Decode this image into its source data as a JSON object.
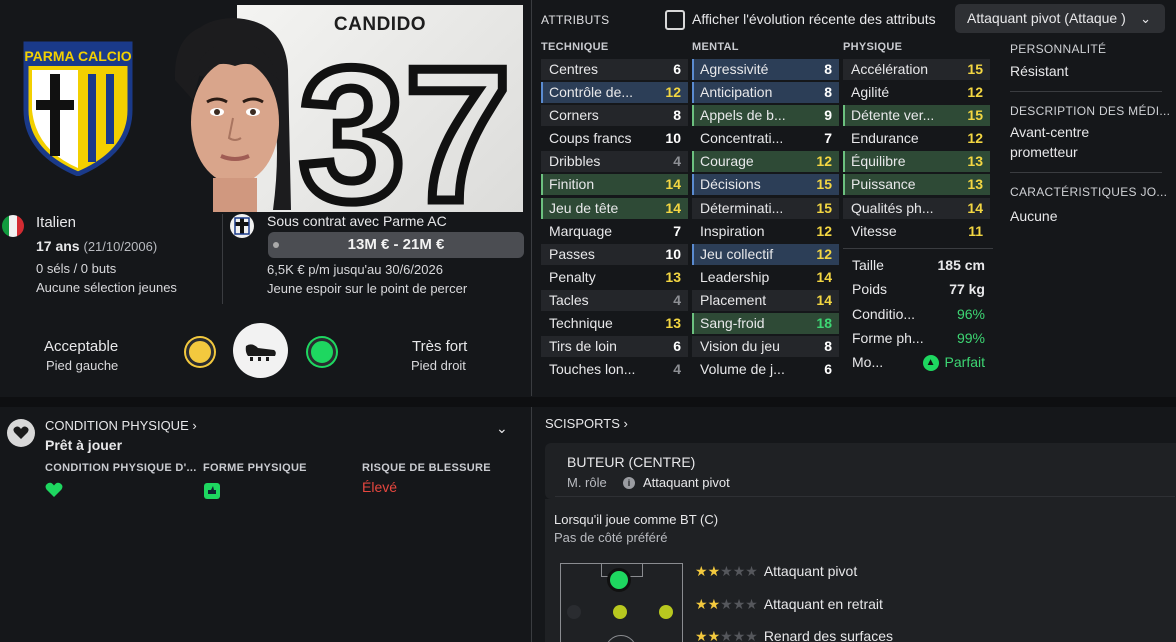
{
  "club": {
    "name": "PARMA CALCIO"
  },
  "player": {
    "name": "CANDIDO",
    "number": "37",
    "nationality": "Italien",
    "age": "17 ans",
    "birth": "(21/10/2006)",
    "caps": "0 séls / 0 buts",
    "youth": "Aucune sélection jeunes",
    "contract": "Sous contrat avec Parme AC",
    "value": "13M € - 21M €",
    "wage": "6,5K € p/m jusqu'au 30/6/2026",
    "status": "Jeune espoir sur le point de percer"
  },
  "feet": {
    "left_level": "Acceptable",
    "left_label": "Pied gauche",
    "right_level": "Très fort",
    "right_label": "Pied droit"
  },
  "attributes": {
    "title": "ATTRIBUTS",
    "toggle_label": "Afficher l'évolution récente des attributs",
    "role_select": "Attaquant pivot (Attaque )",
    "technique_head": "TECHNIQUE",
    "mental_head": "MENTAL",
    "physique_head": "PHYSIQUE",
    "technique": [
      {
        "name": "Centres",
        "value": "6"
      },
      {
        "name": "Contrôle de...",
        "value": "12"
      },
      {
        "name": "Corners",
        "value": "8"
      },
      {
        "name": "Coups francs",
        "value": "10"
      },
      {
        "name": "Dribbles",
        "value": "4"
      },
      {
        "name": "Finition",
        "value": "14"
      },
      {
        "name": "Jeu de tête",
        "value": "14"
      },
      {
        "name": "Marquage",
        "value": "7"
      },
      {
        "name": "Passes",
        "value": "10"
      },
      {
        "name": "Penalty",
        "value": "13"
      },
      {
        "name": "Tacles",
        "value": "4"
      },
      {
        "name": "Technique",
        "value": "13"
      },
      {
        "name": "Tirs de loin",
        "value": "6"
      },
      {
        "name": "Touches lon...",
        "value": "4"
      }
    ],
    "mental": [
      {
        "name": "Agressivité",
        "value": "8"
      },
      {
        "name": "Anticipation",
        "value": "8"
      },
      {
        "name": "Appels de b...",
        "value": "9"
      },
      {
        "name": "Concentrati...",
        "value": "7"
      },
      {
        "name": "Courage",
        "value": "12"
      },
      {
        "name": "Décisions",
        "value": "15"
      },
      {
        "name": "Déterminati...",
        "value": "15"
      },
      {
        "name": "Inspiration",
        "value": "12"
      },
      {
        "name": "Jeu collectif",
        "value": "12"
      },
      {
        "name": "Leadership",
        "value": "14"
      },
      {
        "name": "Placement",
        "value": "14"
      },
      {
        "name": "Sang-froid",
        "value": "18"
      },
      {
        "name": "Vision du jeu",
        "value": "8"
      },
      {
        "name": "Volume de j...",
        "value": "6"
      }
    ],
    "physique": [
      {
        "name": "Accélération",
        "value": "15"
      },
      {
        "name": "Agilité",
        "value": "12"
      },
      {
        "name": "Détente ver...",
        "value": "15"
      },
      {
        "name": "Endurance",
        "value": "12"
      },
      {
        "name": "Équilibre",
        "value": "13"
      },
      {
        "name": "Puissance",
        "value": "13"
      },
      {
        "name": "Qualités ph...",
        "value": "14"
      },
      {
        "name": "Vitesse",
        "value": "11"
      }
    ],
    "stats": [
      {
        "name": "Taille",
        "value": "185 cm"
      },
      {
        "name": "Poids",
        "value": "77 kg"
      },
      {
        "name": "Conditio...",
        "value": "96%"
      },
      {
        "name": "Forme ph...",
        "value": "99%"
      },
      {
        "name": "Mo...",
        "value": "Parfait"
      }
    ]
  },
  "side": {
    "personality_head": "PERSONNALITÉ",
    "personality": "Résistant",
    "media_head": "DESCRIPTION DES MÉDI...",
    "media_line1": "Avant-centre",
    "media_line2": "prometteur",
    "traits_head": "CARACTÉRISTIQUES JO...",
    "traits": "Aucune"
  },
  "fitness": {
    "title": "CONDITION PHYSIQUE",
    "status": "Prêt à jouer",
    "col1": "CONDITION PHYSIQUE D'...",
    "col2": "FORME PHYSIQUE",
    "col3": "RISQUE DE BLESSURE",
    "risk": "Élevé"
  },
  "scisports": {
    "title": "SCISPORTS",
    "role_title": "BUTEUR (CENTRE)",
    "role_label": "M. rôle",
    "role_value": "Attaquant pivot",
    "plays_as": "Lorsqu'il joue comme BT (C)",
    "side_pref": "Pas de côté préféré",
    "roles": [
      {
        "name": "Attaquant pivot",
        "stars": 2
      },
      {
        "name": "Attaquant en retrait",
        "stars": 2
      },
      {
        "name": "Renard des surfaces",
        "stars": 2
      }
    ]
  },
  "colors": {
    "yellow_value": "#f3d642",
    "green_value": "#3dd673",
    "risk": "#e8473f",
    "accent_green": "#1ed760"
  }
}
